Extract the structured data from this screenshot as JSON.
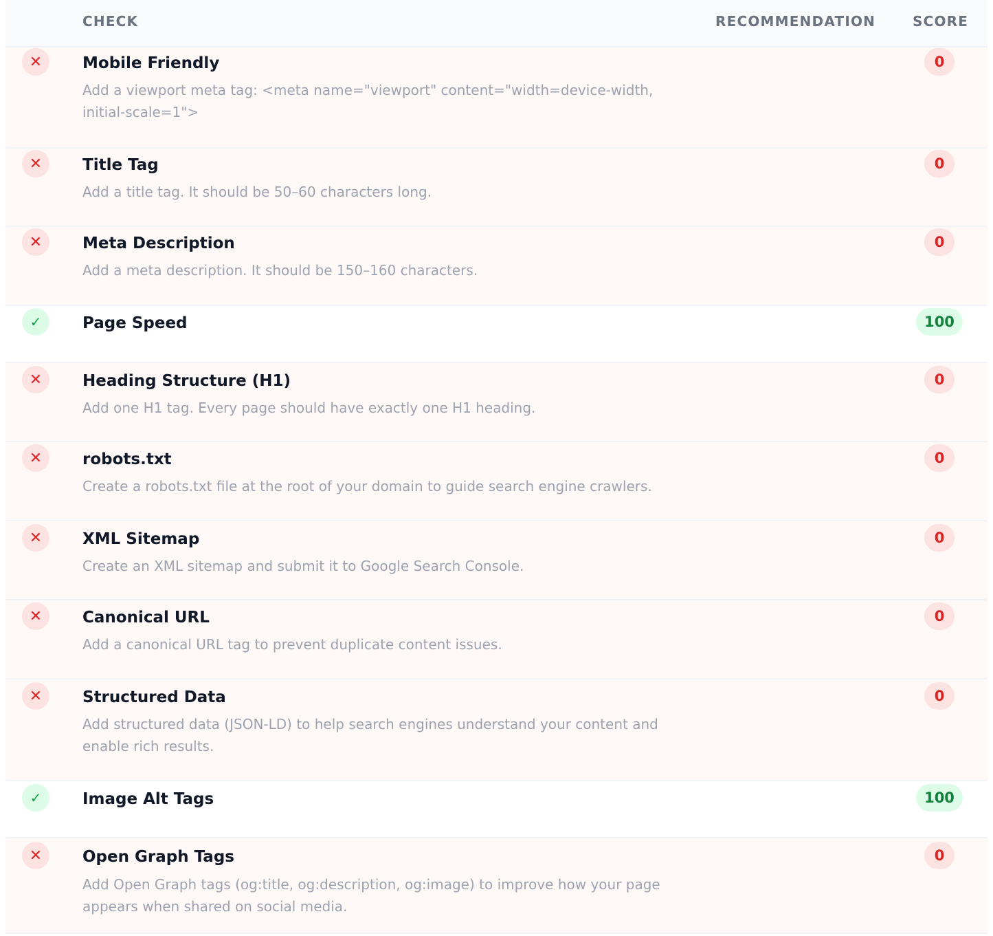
{
  "header": {
    "check": "CHECK",
    "recommendation": "RECOMMENDATION",
    "score": "SCORE"
  },
  "icons": {
    "fail": "x-icon",
    "pass": "check-icon"
  },
  "colors": {
    "fail": "#dc2626",
    "fail_bg": "#fde2e2",
    "pass": "#16a34a",
    "pass_bg": "#dcfce7"
  },
  "rows": [
    {
      "status": "fail",
      "title": "Mobile Friendly",
      "description": "Add a viewport meta tag: <meta name=\"viewport\" content=\"width=device-width, initial-scale=1\">",
      "score": "0"
    },
    {
      "status": "fail",
      "title": "Title Tag",
      "description": "Add a title tag. It should be 50–60 characters long.",
      "score": "0"
    },
    {
      "status": "fail",
      "title": "Meta Description",
      "description": "Add a meta description. It should be 150–160 characters.",
      "score": "0"
    },
    {
      "status": "pass",
      "title": "Page Speed",
      "description": "",
      "score": "100"
    },
    {
      "status": "fail",
      "title": "Heading Structure (H1)",
      "description": "Add one H1 tag. Every page should have exactly one H1 heading.",
      "score": "0"
    },
    {
      "status": "fail",
      "title": "robots.txt",
      "description": "Create a robots.txt file at the root of your domain to guide search engine crawlers.",
      "score": "0"
    },
    {
      "status": "fail",
      "title": "XML Sitemap",
      "description": "Create an XML sitemap and submit it to Google Search Console.",
      "score": "0"
    },
    {
      "status": "fail",
      "title": "Canonical URL",
      "description": "Add a canonical URL tag to prevent duplicate content issues.",
      "score": "0"
    },
    {
      "status": "fail",
      "title": "Structured Data",
      "description": "Add structured data (JSON-LD) to help search engines understand your content and enable rich results.",
      "score": "0"
    },
    {
      "status": "pass",
      "title": "Image Alt Tags",
      "description": "",
      "score": "100"
    },
    {
      "status": "fail",
      "title": "Open Graph Tags",
      "description": "Add Open Graph tags (og:title, og:description, og:image) to improve how your page appears when shared on social media.",
      "score": "0"
    }
  ]
}
